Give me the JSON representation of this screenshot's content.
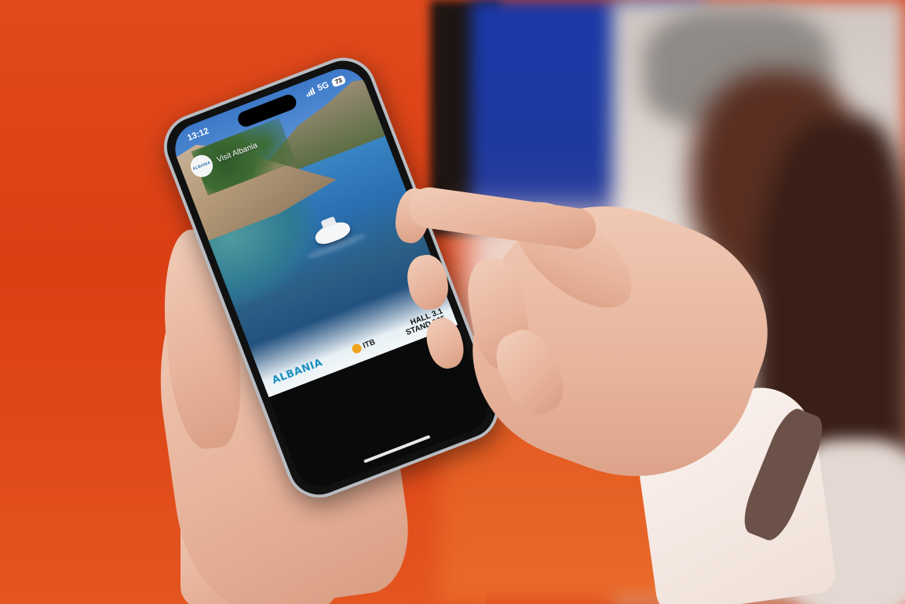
{
  "status_bar": {
    "time": "13:12",
    "network": "5G",
    "battery": "73"
  },
  "story": {
    "account_name": "Visit Albania",
    "avatar_text": "ALBANIA"
  },
  "footer": {
    "brand": "ALBANIA",
    "fair": "ITB",
    "hall": "HALL 3.1",
    "stand": "STAND 105"
  },
  "colors": {
    "background_wall": "#e04a1c",
    "sea": "#2a6fb0",
    "brand": "#1b8fc0"
  }
}
